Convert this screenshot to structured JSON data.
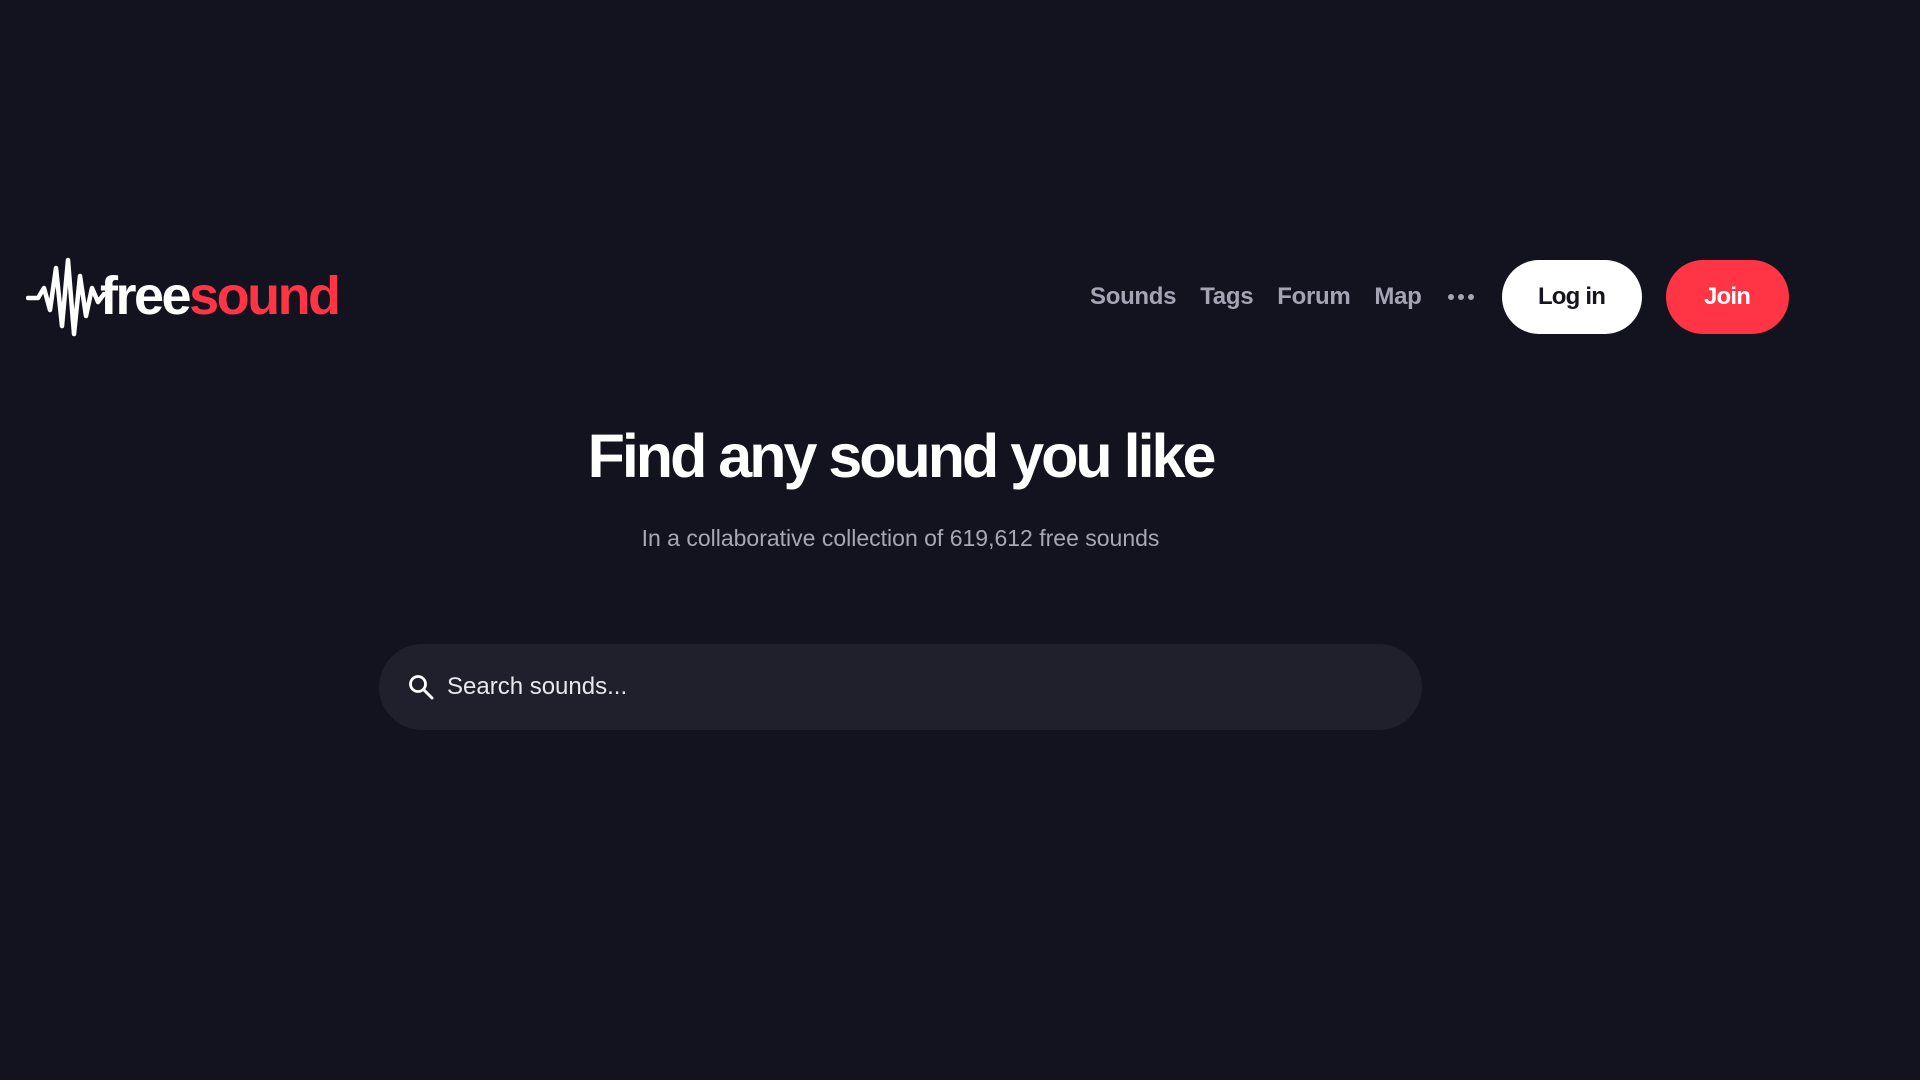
{
  "header": {
    "logo": {
      "icon": "waveform-icon",
      "text_part1": "free",
      "text_part2": "sound",
      "colors": {
        "part1": "#ffffff",
        "part2": "#ff3546"
      }
    },
    "nav": {
      "items": [
        {
          "label": "Sounds"
        },
        {
          "label": "Tags"
        },
        {
          "label": "Forum"
        },
        {
          "label": "Map"
        }
      ],
      "more_icon": "more-horizontal-icon"
    },
    "login_label": "Log in",
    "join_label": "Join"
  },
  "hero": {
    "title": "Find any sound you like",
    "subtitle": "In a collaborative collection of 619,612 free sounds"
  },
  "search": {
    "icon": "search-icon",
    "placeholder": "Search sounds..."
  },
  "colors": {
    "background": "#13131f",
    "accent": "#ff3546",
    "search_bg": "#20202d",
    "nav_text": "#a4a4b4"
  }
}
